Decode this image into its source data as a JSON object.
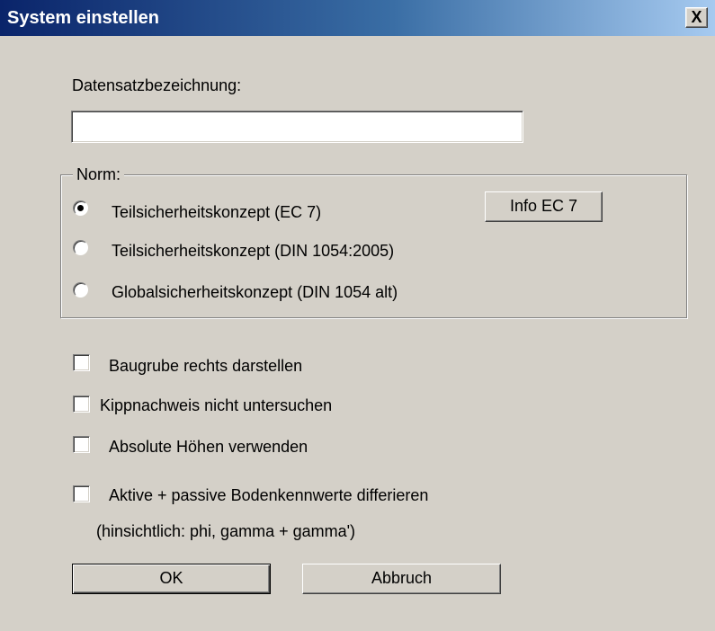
{
  "window": {
    "title": "System einstellen",
    "close_glyph": "X"
  },
  "dataset": {
    "label": "Datensatzbezeichnung:",
    "value": ""
  },
  "norm": {
    "legend": "Norm:",
    "options": [
      {
        "label": "Teilsicherheitskonzept (EC 7)",
        "selected": true
      },
      {
        "label": "Teilsicherheitskonzept (DIN 1054:2005)",
        "selected": false
      },
      {
        "label": "Globalsicherheitskonzept (DIN 1054 alt)",
        "selected": false
      }
    ],
    "info_button": "Info EC 7"
  },
  "options": {
    "baugrube": {
      "label": "Baugrube rechts darstellen",
      "checked": false
    },
    "kippnachweis": {
      "label": "Kippnachweis nicht untersuchen",
      "checked": false
    },
    "absolute": {
      "label": "Absolute Höhen verwenden",
      "checked": false
    },
    "boden": {
      "label": "Aktive + passive Bodenkennwerte differieren",
      "note": "(hinsichtlich: phi, gamma + gamma')",
      "checked": false
    }
  },
  "buttons": {
    "ok": "OK",
    "cancel": "Abbruch"
  },
  "colors": {
    "dialog_bg": "#d4d0c8",
    "title_gradient_start": "#0a246a",
    "title_gradient_end": "#a6caf0"
  }
}
